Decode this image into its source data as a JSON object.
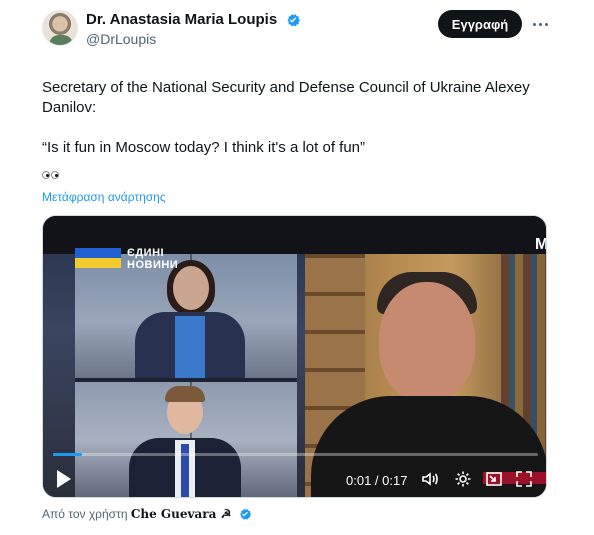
{
  "author": {
    "display_name": "Dr. Anastasia Maria Loupis",
    "handle": "@DrLoupis",
    "verified": true,
    "subscribe_label": "Εγγραφή"
  },
  "tweet": {
    "line1": "Secretary of the National Security and Defense Council of Ukraine Alexey Danilov:",
    "quote": "“Is it fun in Moscow today? I think it's a lot of fun”",
    "translate_label": "Μετάφραση ανάρτησης"
  },
  "video": {
    "channel_logo_line1": "ЄДИНІ",
    "channel_logo_line2": "НОВИНИ",
    "corner_letter": "M",
    "current_time": "0:01",
    "duration": "0:17",
    "time_display": "0:01 / 0:17",
    "progress_fraction": 0.06
  },
  "footer": {
    "prefix": "Από τον χρήστη",
    "author": "Che Guevara ☭"
  },
  "colors": {
    "accent": "#1d9bf0",
    "text": "#0f1419",
    "muted": "#536471"
  }
}
